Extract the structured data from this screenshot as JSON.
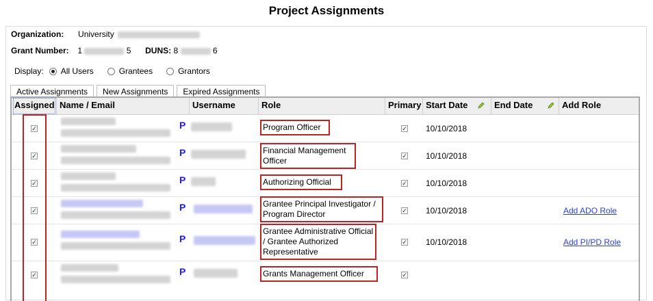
{
  "page": {
    "title": "Project Assignments"
  },
  "info": {
    "organization_label": "Organization:",
    "organization_value": "University",
    "grant_label": "Grant Number:",
    "grant_prefix": "1",
    "grant_suffix": "5",
    "duns_label": "DUNS:",
    "duns_prefix": "8",
    "duns_suffix": "6"
  },
  "display": {
    "label": "Display:",
    "options": [
      "All Users",
      "Grantees",
      "Grantors"
    ],
    "selected": "All Users"
  },
  "tabs": [
    "Active Assignments",
    "New Assignments",
    "Expired Assignments"
  ],
  "table": {
    "headers": {
      "assigned": "Assigned",
      "name_email": "Name / Email",
      "username": "Username",
      "role": "Role",
      "primary": "Primary",
      "start_date": "Start Date",
      "end_date": "End Date",
      "add_role": "Add Role"
    },
    "rows": [
      {
        "role": "Program Officer",
        "start_date": "10/10/2018",
        "add_role": "",
        "primary_mark": "P"
      },
      {
        "role": "Financial Management Officer",
        "start_date": "10/10/2018",
        "add_role": "",
        "primary_mark": "P"
      },
      {
        "role": "Authorizing Official",
        "start_date": "10/10/2018",
        "add_role": "",
        "primary_mark": "P"
      },
      {
        "role": "Grantee Principal Investigator / Program Director",
        "start_date": "10/10/2018",
        "add_role": "Add ADO Role",
        "primary_mark": "P"
      },
      {
        "role": "Grantee Administrative Official / Grantee Authorized Representative",
        "start_date": "10/10/2018",
        "add_role": "Add PI/PD Role",
        "primary_mark": "P"
      },
      {
        "role": "Grants Management Officer",
        "start_date": "",
        "add_role": "",
        "primary_mark": "P"
      }
    ]
  },
  "colors": {
    "highlight": "#bb2222",
    "link": "#2a3fd6",
    "primary_mark": "#1a1aff"
  }
}
